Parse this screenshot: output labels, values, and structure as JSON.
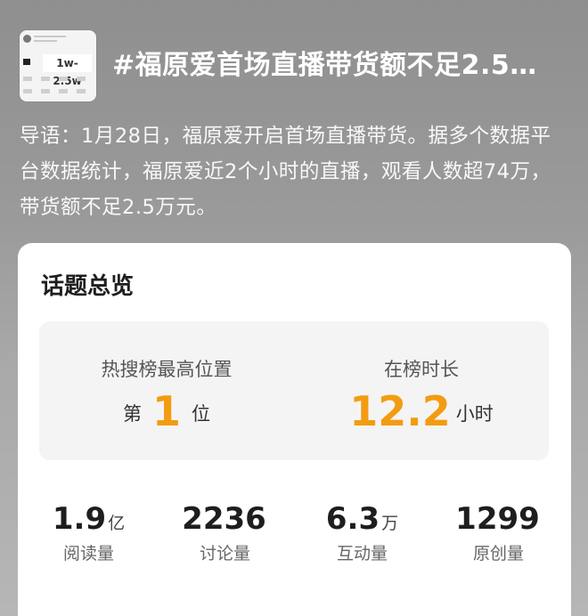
{
  "header": {
    "thumbnail_tag": "1w-2.5w",
    "title": "#福原爱首场直播带货额不足2.5…"
  },
  "intro": "导语：1月28日，福原爱开启首场直播带货。据多个数据平台数据统计，福原爱近2个小时的直播，观看人数超74万，带货额不足2.5万元。",
  "overview": {
    "title": "话题总览",
    "hot_search": {
      "label": "热搜榜最高位置",
      "prefix": "第",
      "value": "1",
      "suffix": "位"
    },
    "duration": {
      "label": "在榜时长",
      "value": "12.2",
      "unit": "小时"
    },
    "accent_color": "#f39c12",
    "stats": [
      {
        "value": "1.9",
        "unit": "亿",
        "label": "阅读量"
      },
      {
        "value": "2236",
        "unit": "",
        "label": "讨论量"
      },
      {
        "value": "6.3",
        "unit": "万",
        "label": "互动量"
      },
      {
        "value": "1299",
        "unit": "",
        "label": "原创量"
      }
    ]
  }
}
